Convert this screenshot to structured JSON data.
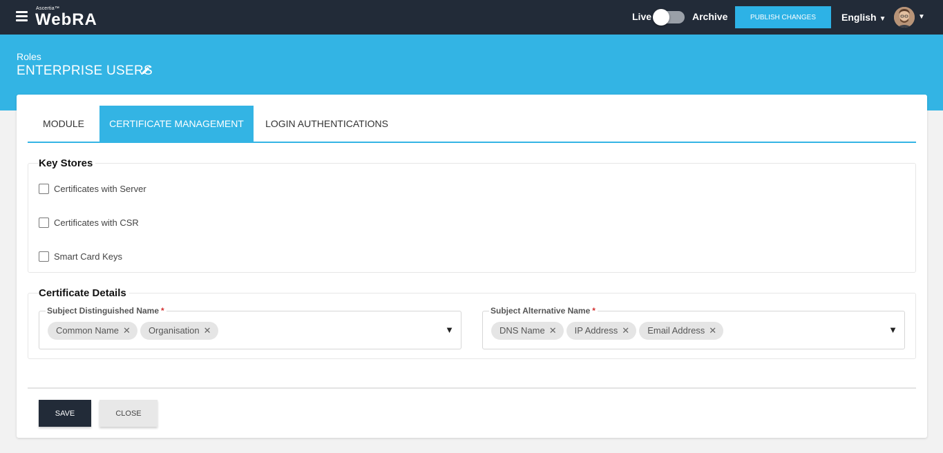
{
  "topbar": {
    "brand_small": "Ascertia™",
    "logo": "WebRA",
    "live_label": "Live",
    "archive_label": "Archive",
    "toggle_state": "live",
    "publish_label": "PUBLISH CHANGES",
    "language": "English",
    "menu_icon": "hamburger-icon",
    "caret_icon": "caret-down-icon"
  },
  "header": {
    "breadcrumb": "Roles",
    "title": "ENTERPRISE USERS",
    "edit_icon": "pencil-icon"
  },
  "tabs": [
    {
      "label": "MODULE",
      "active": false
    },
    {
      "label": "CERTIFICATE MANAGEMENT",
      "active": true
    },
    {
      "label": "LOGIN AUTHENTICATIONS",
      "active": false
    }
  ],
  "key_stores": {
    "legend": "Key Stores",
    "items": [
      {
        "label": "Certificates with Server",
        "checked": false
      },
      {
        "label": "Certificates with CSR",
        "checked": false
      },
      {
        "label": "Smart Card Keys",
        "checked": false
      }
    ]
  },
  "certificate_details": {
    "legend": "Certificate Details",
    "subject_dn": {
      "label": "Subject Distinguished Name",
      "required_mark": "*",
      "chips": [
        "Common Name",
        "Organisation"
      ]
    },
    "subject_alt": {
      "label": "Subject Alternative Name",
      "required_mark": "*",
      "chips": [
        "DNS Name",
        "IP Address",
        "Email Address"
      ]
    }
  },
  "actions": {
    "save_label": "SAVE",
    "close_label": "CLOSE"
  },
  "colors": {
    "topbar": "#222b38",
    "accent": "#33b4e4",
    "publish": "#2db2e6",
    "required": "#d32f2f"
  }
}
